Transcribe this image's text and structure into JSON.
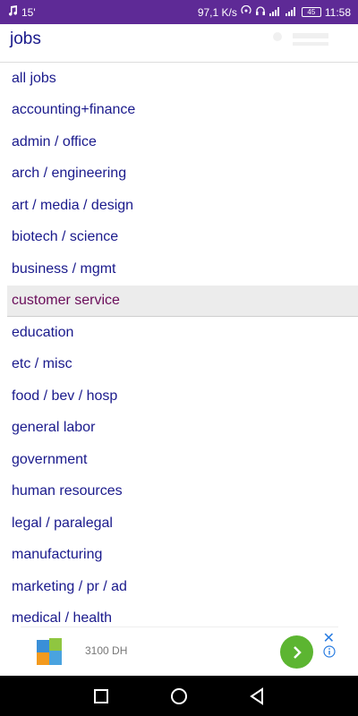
{
  "status_bar": {
    "left_text": "15'",
    "speed": "97,1 K/s",
    "battery": "45",
    "time": "11:58"
  },
  "header": {
    "title": "jobs"
  },
  "job_list": [
    {
      "label": "all jobs",
      "selected": false
    },
    {
      "label": "accounting+finance",
      "selected": false
    },
    {
      "label": "admin / office",
      "selected": false
    },
    {
      "label": "arch / engineering",
      "selected": false
    },
    {
      "label": "art / media / design",
      "selected": false
    },
    {
      "label": "biotech / science",
      "selected": false
    },
    {
      "label": "business / mgmt",
      "selected": false
    },
    {
      "label": "customer service",
      "selected": true
    },
    {
      "label": "education",
      "selected": false
    },
    {
      "label": "etc / misc",
      "selected": false
    },
    {
      "label": "food / bev / hosp",
      "selected": false
    },
    {
      "label": "general labor",
      "selected": false
    },
    {
      "label": "government",
      "selected": false
    },
    {
      "label": "human resources",
      "selected": false
    },
    {
      "label": "legal / paralegal",
      "selected": false
    },
    {
      "label": "manufacturing",
      "selected": false
    },
    {
      "label": "marketing / pr / ad",
      "selected": false
    },
    {
      "label": "medical / health",
      "selected": false
    }
  ],
  "ad": {
    "text": "3100 DH",
    "close_label": "✕",
    "go_color": "#5cb531"
  },
  "colors": {
    "status_bar": "#5e2a96",
    "link": "#1a1a8c",
    "selected_text": "#6a0d5a",
    "selected_bg": "#ececec"
  }
}
